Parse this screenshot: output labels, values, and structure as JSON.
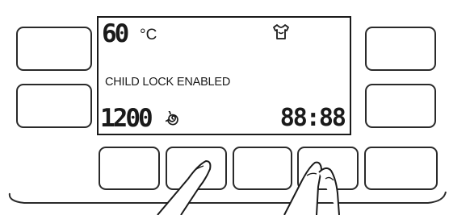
{
  "display": {
    "temperature": "60",
    "temperature_unit": "°C",
    "status_message": "CHILD LOCK ENABLED",
    "spin_speed": "1200",
    "time": "88:88"
  },
  "icons": {
    "garment": "shirt-icon",
    "spin": "spin-spiral-icon",
    "hands": "pressing-hands-icon"
  }
}
